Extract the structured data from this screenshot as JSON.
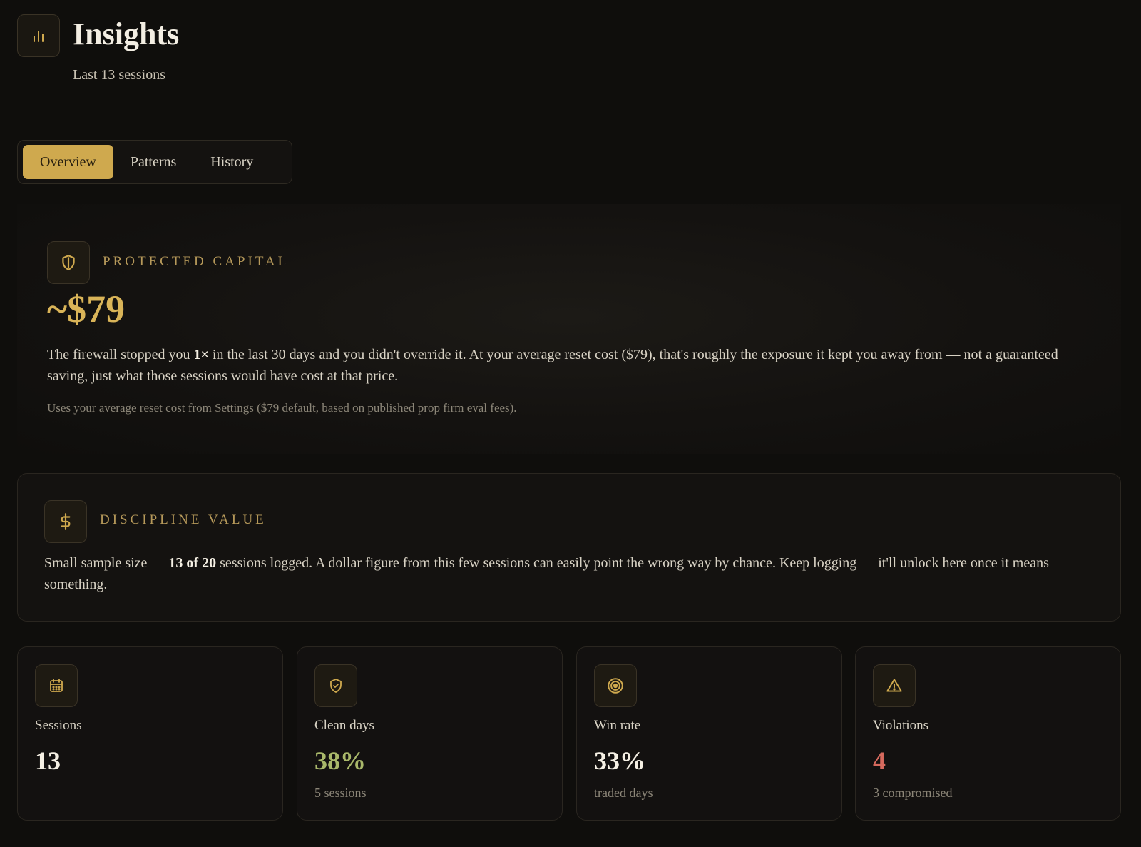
{
  "header": {
    "title": "Insights",
    "subtitle": "Last 13 sessions",
    "icon": "bar-chart-icon"
  },
  "tabs": [
    {
      "label": "Overview",
      "active": true
    },
    {
      "label": "Patterns",
      "active": false
    },
    {
      "label": "History",
      "active": false
    }
  ],
  "protected_capital": {
    "icon": "shield-icon",
    "label": "PROTECTED CAPITAL",
    "amount": "~$79",
    "text_before": "The firewall stopped you ",
    "text_bold": "1×",
    "text_after": " in the last 30 days and you didn't override it. At your average reset cost ($79), that's roughly the exposure it kept you away from — not a guaranteed saving, just what those sessions would have cost at that price.",
    "note": "Uses your average reset cost from Settings ($79 default, based on published prop firm eval fees)."
  },
  "discipline_value": {
    "icon": "dollar-icon",
    "label": "DISCIPLINE VALUE",
    "text_before": "Small sample size — ",
    "text_bold": "13 of 20",
    "text_after": " sessions logged. A dollar figure from this few sessions can easily point the wrong way by chance. Keep logging — it'll unlock here once it means something."
  },
  "stats": [
    {
      "icon": "calendar-icon",
      "label": "Sessions",
      "value": "13",
      "sub": "",
      "value_color": "#f5f0e4"
    },
    {
      "icon": "shield-check-icon",
      "label": "Clean days",
      "value": "38%",
      "sub": "5 sessions",
      "value_color": "#a9b86a"
    },
    {
      "icon": "target-icon",
      "label": "Win rate",
      "value": "33%",
      "sub": "traded days",
      "value_color": "#f5f0e4"
    },
    {
      "icon": "warning-icon",
      "label": "Violations",
      "value": "4",
      "sub": "3 compromised",
      "value_color": "#d66a5e"
    }
  ],
  "colors": {
    "accent": "#cfa94e",
    "background": "#0f0e0c",
    "positive": "#a9b86a",
    "negative": "#d66a5e"
  }
}
